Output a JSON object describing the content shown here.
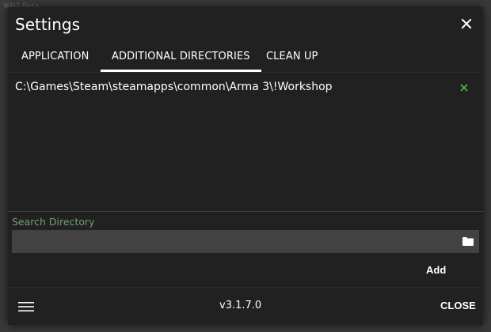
{
  "background": {
    "ghost_text": "WH2 Beta"
  },
  "dialog": {
    "title": "Settings",
    "close_icon": "close-icon"
  },
  "tabs": [
    {
      "label": "APPLICATION",
      "active": false
    },
    {
      "label": "ADDITIONAL DIRECTORIES",
      "active": true
    },
    {
      "label": "CLEAN UP",
      "active": false
    }
  ],
  "directories": [
    {
      "path": "C:\\Games\\Steam\\steamapps\\common\\Arma 3\\!Workshop",
      "remove_icon": "remove-icon"
    }
  ],
  "search": {
    "label": "Search Directory",
    "value": "",
    "placeholder": "",
    "browse_icon": "folder-icon"
  },
  "actions": {
    "add_label": "Add"
  },
  "footer": {
    "menu_icon": "hamburger-menu-icon",
    "version": "v3.1.7.0",
    "close_label": "CLOSE"
  },
  "colors": {
    "dialog_bg": "#212121",
    "input_bg": "#424242",
    "label_green": "#6fa06f",
    "remove_green": "#4caf50",
    "text": "#ffffff"
  }
}
